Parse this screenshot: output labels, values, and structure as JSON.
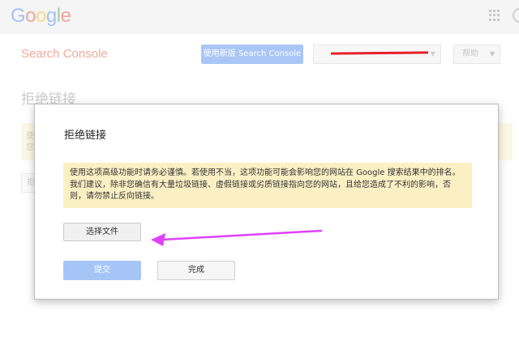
{
  "header": {
    "logo_letters": [
      {
        "char": "G",
        "color": "#4285f4"
      },
      {
        "char": "o",
        "color": "#ea4335"
      },
      {
        "char": "o",
        "color": "#fbbc05"
      },
      {
        "char": "g",
        "color": "#4285f4"
      },
      {
        "char": "l",
        "color": "#34a853"
      },
      {
        "char": "e",
        "color": "#ea4335"
      }
    ],
    "apps_icon": "apps-grid-icon",
    "avatar_icon": "account-avatar-icon"
  },
  "toolbar": {
    "product_title": "Search Console",
    "new_version_label": "使用新版 Search Console",
    "property_value": "",
    "help_label": "帮助"
  },
  "page": {
    "heading": "拒绝链接"
  },
  "dialog": {
    "title": "拒绝链接",
    "warning_text": "使用这项高级功能时请务必谨慎。若使用不当，这项功能可能会影响您的网站在 Google 搜索结果中的排名。我们建议，除非您确信有大量垃圾链接、虚假链接或劣质链接指向您的网站，且给您造成了不利的影响，否则，请勿禁止反向链接。",
    "choose_file_label": "选择文件",
    "submit_label": "提交",
    "done_label": "完成"
  },
  "annotation": {
    "arrow_color": "#e040fb",
    "redaction_color": "#e8202a"
  },
  "colors": {
    "primary_button": "#a5c5f7",
    "warning_background": "#fbf0c4",
    "product_title": "#f2a99a"
  }
}
